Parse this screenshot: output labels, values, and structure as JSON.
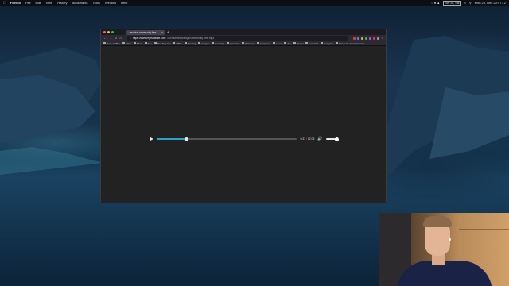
{
  "menubar": {
    "app_name": "Firefox",
    "menus": [
      "File",
      "Edit",
      "View",
      "History",
      "Bookmarks",
      "Tools",
      "Window",
      "Help"
    ],
    "status_badge": "Nov 28, Sat",
    "clock": "Mon 28. Dec 20:47:12"
  },
  "browser": {
    "tab": {
      "title": "archive.community.free..."
    },
    "url": {
      "host": "https://www.myrradente.com",
      "path": "/archive/recordings/community-free.mp3"
    },
    "bookmarks": [
      "PersonalBox",
      "Skills",
      "Mind",
      "Sex",
      "Reading List",
      "Office",
      "Trading",
      "Images",
      "Learning",
      "parenting",
      "Watches",
      "Instagram",
      "Head",
      "dev",
      "Travel",
      "unsorted",
      "Analytics",
      "Elements de Grammaire"
    ],
    "extension_colors": [
      "#e23c3c",
      "#3f8ff0",
      "#e9a23b",
      "#33b35a",
      "#c84bc8",
      "#e23c3c",
      "#9b9b9b"
    ]
  },
  "player": {
    "current_time": "0:31",
    "duration": "12:05",
    "progress": 0.21,
    "volume": 1.0,
    "accent": "#29a3c2"
  },
  "colors": {
    "window_bg": "#212121",
    "menubar_bg": "#0b0f14"
  }
}
